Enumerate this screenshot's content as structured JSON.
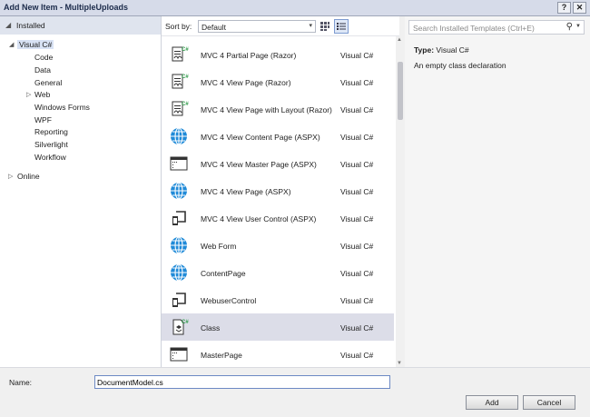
{
  "window": {
    "title": "Add New Item - MultipleUploads",
    "help_label": "?",
    "close_label": "✕"
  },
  "left": {
    "installed_label": "Installed",
    "tree": [
      {
        "label": "Visual C#",
        "expander": "◢",
        "selected": true
      },
      {
        "label": "Code"
      },
      {
        "label": "Data"
      },
      {
        "label": "General"
      },
      {
        "label": "Web",
        "expander": "▷"
      },
      {
        "label": "Windows Forms"
      },
      {
        "label": "WPF"
      },
      {
        "label": "Reporting"
      },
      {
        "label": "Silverlight"
      },
      {
        "label": "Workflow"
      },
      {
        "label": "Online",
        "expander": "▷"
      }
    ]
  },
  "toolbar": {
    "sort_label": "Sort by:",
    "sort_value": "Default",
    "grid_view_icon": "small-icons-view-icon",
    "list_view_icon": "list-view-icon"
  },
  "templates": [
    {
      "name": "MVC 4 Partial Page (Razor)",
      "type": "Visual C#",
      "icon": "razor-page-icon"
    },
    {
      "name": "MVC 4 View Page (Razor)",
      "type": "Visual C#",
      "icon": "razor-page-icon"
    },
    {
      "name": "MVC 4 View Page with Layout (Razor)",
      "type": "Visual C#",
      "icon": "razor-page-icon"
    },
    {
      "name": "MVC 4 View Content Page (ASPX)",
      "type": "Visual C#",
      "icon": "globe-icon"
    },
    {
      "name": "MVC 4 View Master Page (ASPX)",
      "type": "Visual C#",
      "icon": "master-page-icon"
    },
    {
      "name": "MVC 4 View Page (ASPX)",
      "type": "Visual C#",
      "icon": "globe-icon"
    },
    {
      "name": "MVC 4 View User Control (ASPX)",
      "type": "Visual C#",
      "icon": "user-control-icon"
    },
    {
      "name": "Web Form",
      "type": "Visual C#",
      "icon": "globe-icon"
    },
    {
      "name": "ContentPage",
      "type": "Visual C#",
      "icon": "globe-icon"
    },
    {
      "name": "WebuserControl",
      "type": "Visual C#",
      "icon": "user-control-icon"
    },
    {
      "name": "Class",
      "type": "Visual C#",
      "icon": "class-icon",
      "selected": true
    },
    {
      "name": "MasterPage",
      "type": "Visual C#",
      "icon": "master-page-icon"
    }
  ],
  "right": {
    "search_placeholder": "Search Installed Templates (Ctrl+E)",
    "type_label": "Type:",
    "type_value": "Visual C#",
    "description": "An empty class declaration"
  },
  "bottom": {
    "name_label": "Name:",
    "name_value": "DocumentModel.cs",
    "add_label": "Add",
    "cancel_label": "Cancel"
  },
  "colors": {
    "globe": "#1f8ad8",
    "csharp_badge": "#2f9a4a",
    "selection": "#dcdde8"
  }
}
